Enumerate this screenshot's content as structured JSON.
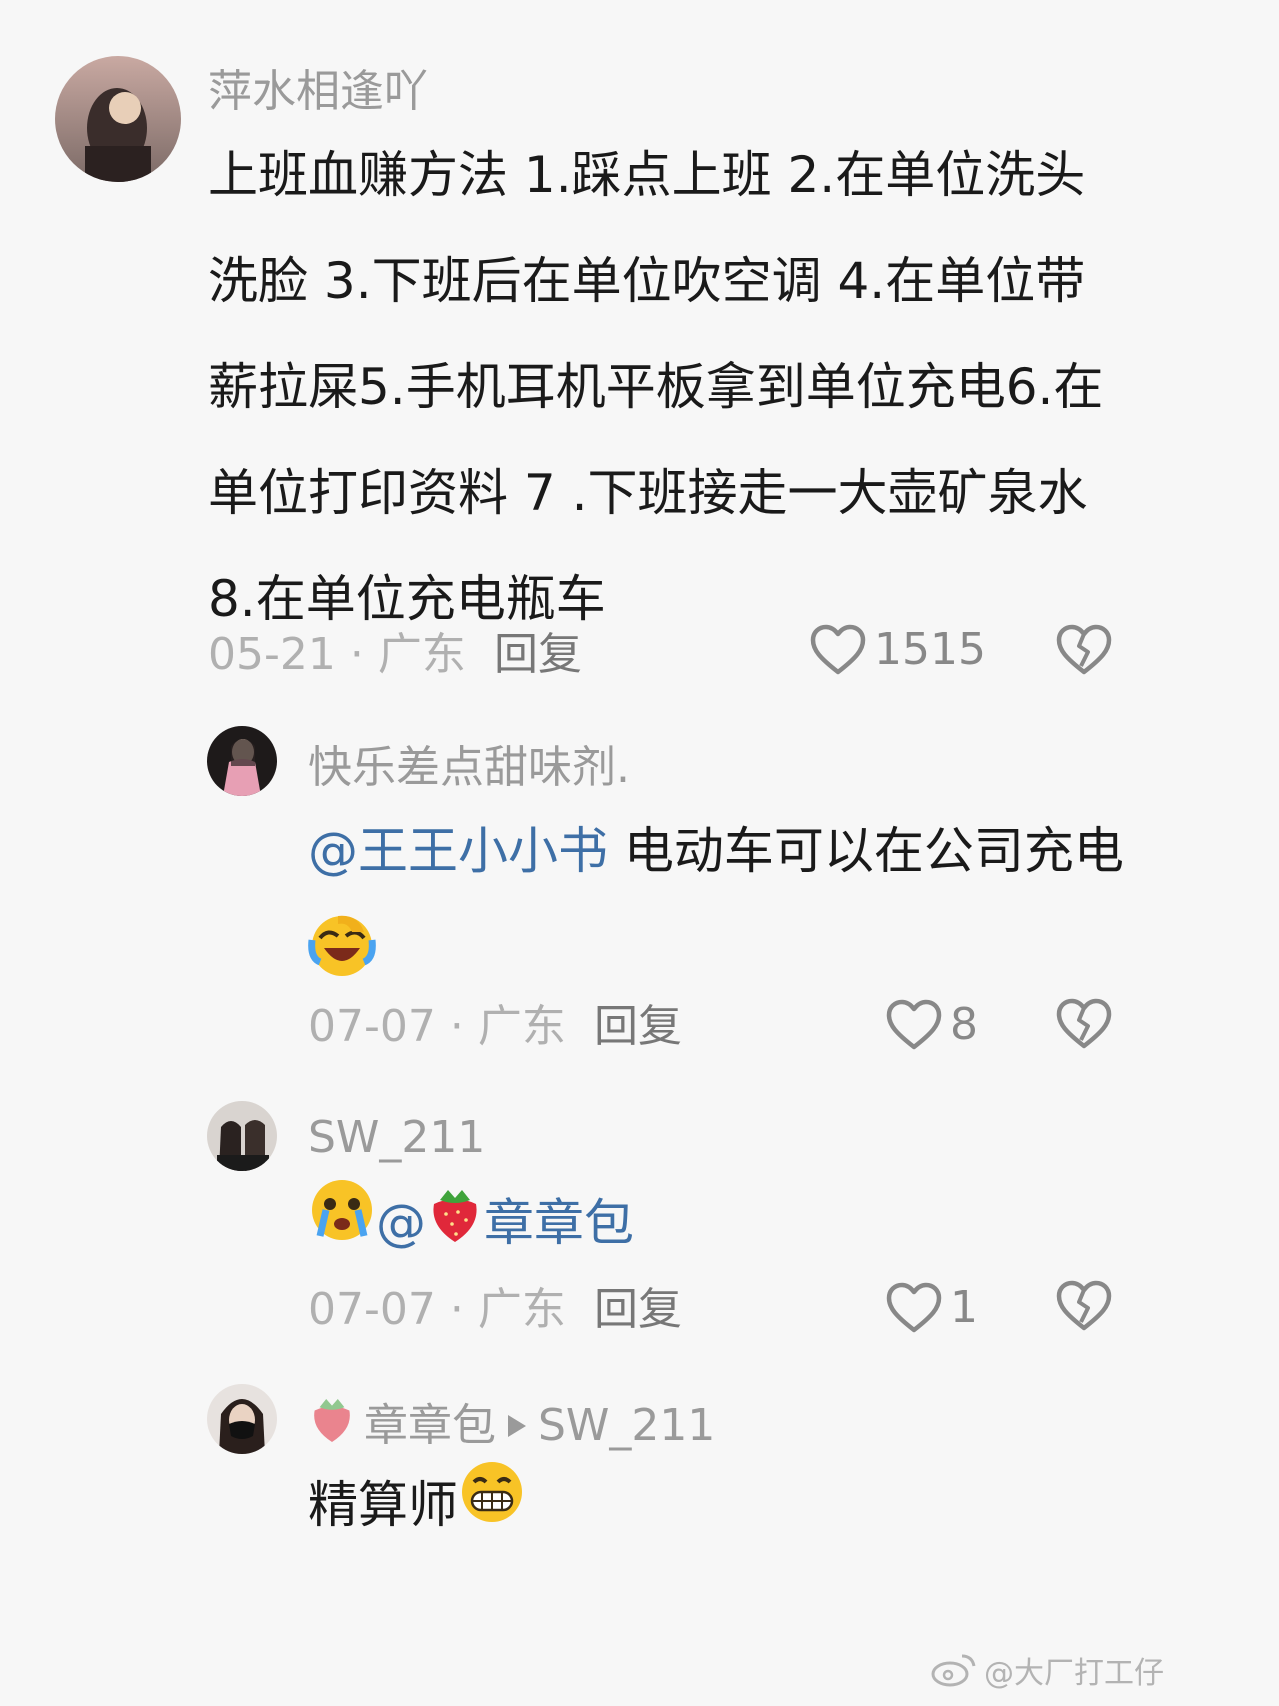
{
  "comments": [
    {
      "username": "萍水相逢吖",
      "text": "上班血赚方法 1.踩点上班 2.在单位洗头洗脸 3.下班后在单位吹空调 4.在单位带薪拉屎5.手机耳机平板拿到单位充电6.在单位打印资料 7 .下班接走一大壶矿泉水 8.在单位充电瓶车",
      "date": "05-21",
      "location": "广东",
      "reply_label": "回复",
      "likes": "1515"
    },
    {
      "username": "快乐差点甜味剂.",
      "mention": "@王王小小书",
      "text": " 电动车可以在公司充电",
      "emoji": "laugh-cry-emoji",
      "date": "07-07",
      "location": "广东",
      "reply_label": "回复",
      "likes": "8"
    },
    {
      "username": "SW_211",
      "mention_at": "@",
      "mention_name": "章章包",
      "emoji": "crying-emoji",
      "date": "07-07",
      "location": "广东",
      "reply_label": "回复",
      "likes": "1"
    },
    {
      "username": "章章包",
      "reply_to": "SW_211",
      "text": "精算师",
      "emoji": "grin-emoji"
    }
  ],
  "separator": " · ",
  "watermark": "@大厂打工仔",
  "colors": {
    "mention": "#3e6fa6",
    "meta": "#b0b0b0",
    "username": "#9a9a9a"
  }
}
